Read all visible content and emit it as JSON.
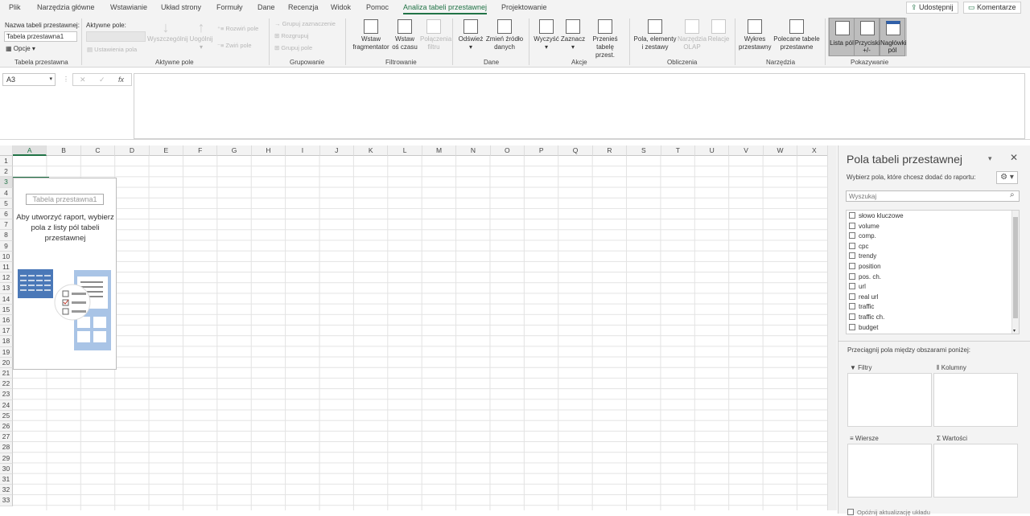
{
  "menu": {
    "tabs": [
      "Plik",
      "Narzędzia główne",
      "Wstawianie",
      "Układ strony",
      "Formuły",
      "Dane",
      "Recenzja",
      "Widok",
      "Pomoc",
      "Analiza tabeli przestawnej",
      "Projektowanie"
    ],
    "share": "Udostępnij",
    "comments": "Komentarze"
  },
  "ribbon": {
    "pivot_name_label": "Nazwa tabeli przestawnej:",
    "pivot_name_value": "Tabela przestawna1",
    "options": "Opcje",
    "group_pivot": "Tabela przestawna",
    "active_field_label": "Aktywne pole:",
    "field_settings": "Ustawienia pola",
    "drill_down": "Wyszczególnij",
    "drill_up": "Uogólnij",
    "expand_field": "Rozwiń pole",
    "collapse_field": "Zwiń pole",
    "group_active": "Aktywne pole",
    "group_selection": "Grupuj zaznaczenie",
    "ungroup": "Rozgrupuj",
    "group_field": "Grupuj pole",
    "group_grouping": "Grupowanie",
    "insert_slicer": "Wstaw fragmentator",
    "insert_timeline": "Wstaw oś czasu",
    "filter_connections": "Połączenia filtru",
    "group_filter": "Filtrowanie",
    "refresh": "Odśwież",
    "change_source": "Zmień źródło danych",
    "group_data": "Dane",
    "clear": "Wyczyść",
    "select": "Zaznacz",
    "move_pivot": "Przenieś tabelę przest.",
    "group_actions": "Akcje",
    "fields_items": "Pola, elementy i zestawy",
    "olap_tools": "Narzędzia OLAP",
    "relationships": "Relacje",
    "group_calc": "Obliczenia",
    "pivot_chart": "Wykres przestawny",
    "recommended": "Polecane tabele przestawne",
    "group_tools": "Narzędzia",
    "field_list": "Lista pól",
    "buttons": "Przyciski +/-",
    "headers": "Nagłówki pól",
    "group_show": "Pokazywanie"
  },
  "formula": {
    "cell": "A3",
    "fx": "fx"
  },
  "sheet": {
    "columns": [
      "A",
      "B",
      "C",
      "D",
      "E",
      "F",
      "G",
      "H",
      "I",
      "J",
      "K",
      "L",
      "M",
      "N",
      "O",
      "P",
      "Q",
      "R",
      "S",
      "T",
      "U",
      "V",
      "W",
      "X"
    ],
    "rows": [
      "1",
      "2",
      "3",
      "4",
      "5",
      "6",
      "7",
      "8",
      "9",
      "10",
      "11",
      "12",
      "13",
      "14",
      "15",
      "16",
      "17",
      "18",
      "19",
      "20",
      "21",
      "22",
      "23",
      "24",
      "25",
      "26",
      "27",
      "28",
      "29",
      "30",
      "31",
      "32",
      "33"
    ],
    "selected_cell": "A3",
    "pivot_placeholder_name": "Tabela przestawna1",
    "pivot_placeholder_msg": "Aby utworzyć raport, wybierz pola z listy pól tabeli przestawnej"
  },
  "pane": {
    "title": "Pola tabeli przestawnej",
    "subtitle": "Wybierz pola, które chcesz dodać do raportu:",
    "search_placeholder": "Wyszukaj",
    "fields": [
      "słowo kluczowe",
      "volume",
      "comp.",
      "cpc",
      "trendy",
      "position",
      "pos. ch.",
      "url",
      "real url",
      "traffic",
      "traffic ch.",
      "budget"
    ],
    "drag_text": "Przeciągnij pola między obszarami poniżej:",
    "areas": [
      "Filtry",
      "Kolumny",
      "Wiersze",
      "Wartości"
    ],
    "defer": "Opóźnij aktualizację układu"
  },
  "colors": {
    "accent": "#217346"
  }
}
